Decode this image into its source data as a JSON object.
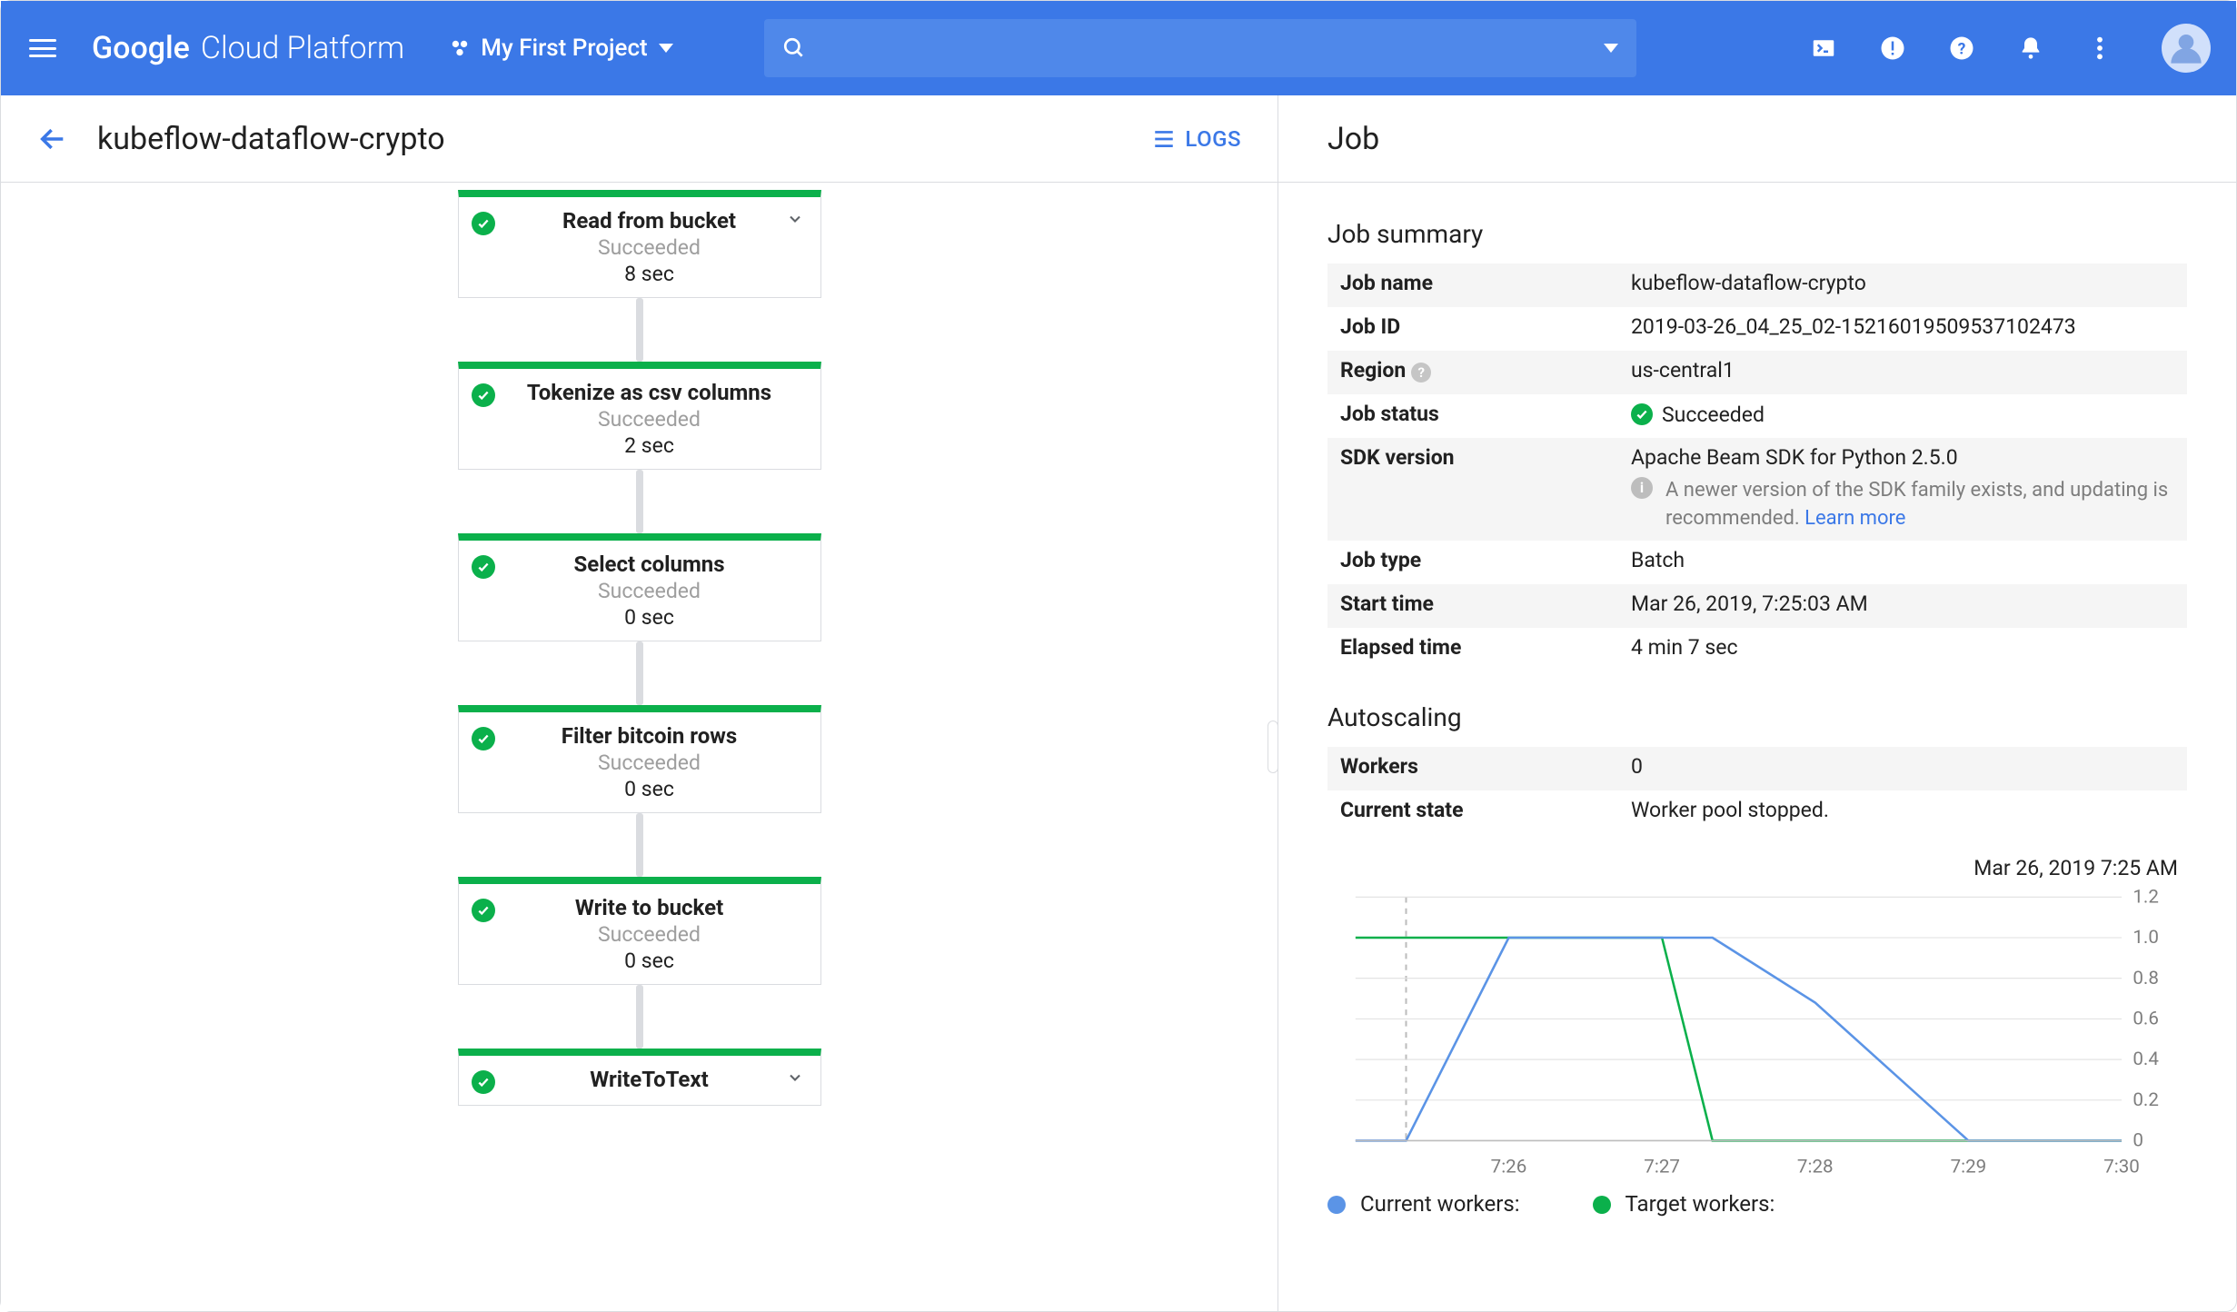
{
  "header": {
    "brand_bold": "Google",
    "brand_regular": "Cloud Platform",
    "project_name": "My First Project"
  },
  "page": {
    "title": "kubeflow-dataflow-crypto",
    "logs_label": "LOGS",
    "panel_title": "Job"
  },
  "flow_nodes": [
    {
      "title": "Read from bucket",
      "status": "Succeeded",
      "time": "8 sec",
      "chevron": true
    },
    {
      "title": "Tokenize as csv columns",
      "status": "Succeeded",
      "time": "2 sec",
      "chevron": false
    },
    {
      "title": "Select columns",
      "status": "Succeeded",
      "time": "0 sec",
      "chevron": false
    },
    {
      "title": "Filter bitcoin rows",
      "status": "Succeeded",
      "time": "0 sec",
      "chevron": false
    },
    {
      "title": "Write to bucket",
      "status": "Succeeded",
      "time": "0 sec",
      "chevron": false
    },
    {
      "title": "WriteToText",
      "status": "",
      "time": "",
      "chevron": true
    }
  ],
  "job_summary": {
    "title": "Job summary",
    "rows": {
      "job_name_k": "Job name",
      "job_name_v": "kubeflow-dataflow-crypto",
      "job_id_k": "Job ID",
      "job_id_v": "2019-03-26_04_25_02-15216019509537102473",
      "region_k": "Region",
      "region_v": "us-central1",
      "job_status_k": "Job status",
      "job_status_v": "Succeeded",
      "sdk_k": "SDK version",
      "sdk_v": "Apache Beam SDK for Python 2.5.0",
      "sdk_note": "A newer version of the SDK family exists, and updating is recommended.",
      "sdk_learn": "Learn more",
      "job_type_k": "Job type",
      "job_type_v": "Batch",
      "start_k": "Start time",
      "start_v": "Mar 26, 2019, 7:25:03 AM",
      "elapsed_k": "Elapsed time",
      "elapsed_v": "4 min 7 sec"
    }
  },
  "autoscaling": {
    "title": "Autoscaling",
    "workers_k": "Workers",
    "workers_v": "0",
    "state_k": "Current state",
    "state_v": "Worker pool stopped."
  },
  "chart": {
    "timestamp": "Mar 26, 2019 7:25 AM",
    "legend_current": "Current workers:",
    "legend_target": "Target workers:",
    "colors": {
      "current": "#5b94e6",
      "target": "#0bb04b",
      "grid": "#e0e0e0",
      "axis": "#bdbdbd"
    },
    "x_ticks": [
      "7:26",
      "7:27",
      "7:28",
      "7:29",
      "7:30"
    ],
    "y_ticks": [
      "0",
      "0.2",
      "0.4",
      "0.6",
      "0.8",
      "1.0",
      "1.2"
    ]
  },
  "chart_data": {
    "type": "line",
    "title": "",
    "xlabel": "",
    "ylabel": "",
    "ylim": [
      0,
      1.2
    ],
    "x": [
      7.25,
      7.2533,
      7.26,
      7.27,
      7.2733,
      7.28,
      7.29,
      7.3
    ],
    "series": [
      {
        "name": "Current workers",
        "values": [
          0,
          0,
          1,
          1,
          1,
          0.68,
          0,
          0
        ]
      },
      {
        "name": "Target workers",
        "values": [
          1,
          1,
          1,
          1,
          0,
          0,
          0,
          0
        ]
      }
    ]
  }
}
